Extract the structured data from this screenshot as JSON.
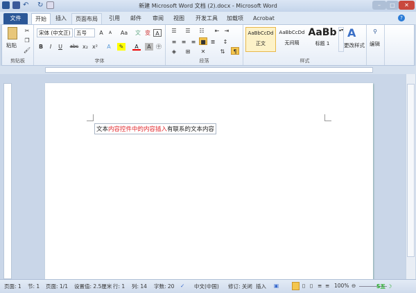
{
  "window": {
    "title": "新建 Microsoft Word 文档 (2).docx - Microsoft Word"
  },
  "tabs": [
    {
      "label": "文件"
    },
    {
      "label": "开始"
    },
    {
      "label": "插入"
    },
    {
      "label": "页面布局"
    },
    {
      "label": "引用"
    },
    {
      "label": "邮件"
    },
    {
      "label": "审阅"
    },
    {
      "label": "视图"
    },
    {
      "label": "开发工具"
    },
    {
      "label": "加载项"
    },
    {
      "label": "Acrobat"
    }
  ],
  "ribbon": {
    "clipboard": {
      "label": "剪贴板",
      "paste": "粘贴"
    },
    "font": {
      "label": "字体",
      "font_name": "宋体 (中文正)",
      "font_size": "五号",
      "buttons": [
        "B",
        "I",
        "U",
        "abc",
        "x₂",
        "x²",
        "A",
        "A",
        "Aa"
      ]
    },
    "paragraph": {
      "label": "段落"
    },
    "styles": {
      "label": "样式",
      "items": [
        {
          "preview": "AaBbCcDd",
          "name": "正文"
        },
        {
          "preview": "AaBbCcDd",
          "name": "无间隔"
        },
        {
          "preview": "AaBb",
          "name": "标题 1"
        }
      ],
      "change": "更改样式"
    },
    "editing": {
      "label": "编辑"
    }
  },
  "document": {
    "prefix": "文本",
    "red_text": "内容控件中的内容插入",
    "suffix": "有联系的文本内容",
    "accent": "#e0262b"
  },
  "status": {
    "page": "页面: 1",
    "section": "节: 1",
    "pages": "页面: 1/1",
    "position": "设置值: 2.5厘米",
    "line": "行: 1",
    "column": "列: 14",
    "words": "字数: 20",
    "language": "中文(中国)",
    "track": "修订: 关闭",
    "mode": "插入",
    "zoom": "100%"
  }
}
